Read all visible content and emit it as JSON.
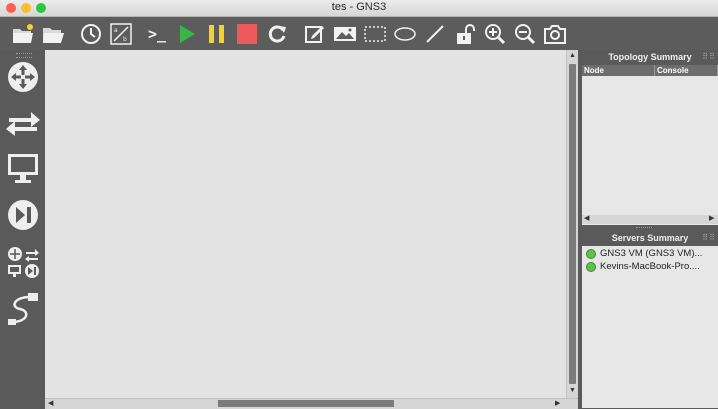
{
  "window": {
    "title": "tes - GNS3",
    "traffic_lights": {
      "close": "#ff5f57",
      "minimize": "#febc2e",
      "zoom": "#28c840"
    }
  },
  "toolbar": {
    "items": [
      {
        "name": "new-project-icon"
      },
      {
        "name": "open-project-icon"
      },
      {
        "name": "snapshot-clock-icon"
      },
      {
        "name": "show-interface-labels-icon"
      },
      {
        "name": "console-all-icon",
        "glyph": ">_"
      },
      {
        "name": "start-all-icon",
        "color": "#39b54a"
      },
      {
        "name": "suspend-all-icon",
        "color": "#f5d327"
      },
      {
        "name": "stop-all-icon",
        "color": "#ee5a5a"
      },
      {
        "name": "reload-all-icon"
      },
      {
        "name": "add-note-icon"
      },
      {
        "name": "insert-picture-icon"
      },
      {
        "name": "draw-rectangle-icon"
      },
      {
        "name": "draw-ellipse-icon"
      },
      {
        "name": "draw-line-icon"
      },
      {
        "name": "lock-unlock-icon"
      },
      {
        "name": "zoom-in-icon"
      },
      {
        "name": "zoom-out-icon"
      },
      {
        "name": "screenshot-icon"
      }
    ]
  },
  "sidebar": {
    "items": [
      {
        "name": "browse-routers-icon"
      },
      {
        "name": "browse-switches-icon"
      },
      {
        "name": "browse-end-devices-icon"
      },
      {
        "name": "browse-security-devices-icon"
      },
      {
        "name": "browse-all-devices-icon"
      },
      {
        "name": "add-link-icon"
      }
    ]
  },
  "topology_summary": {
    "title": "Topology Summary",
    "columns": [
      "Node",
      "Console"
    ],
    "rows": []
  },
  "servers_summary": {
    "title": "Servers Summary",
    "servers": [
      {
        "label": "GNS3 VM (GNS3 VM)...",
        "status_color": "#5cc24a"
      },
      {
        "label": "Kevins-MacBook-Pro....",
        "status_color": "#5cc24a"
      }
    ]
  },
  "colors": {
    "toolbar_bg": "#5c5c5c",
    "canvas_bg": "#e3e3e3",
    "panel_bg": "#e7e7e7"
  }
}
